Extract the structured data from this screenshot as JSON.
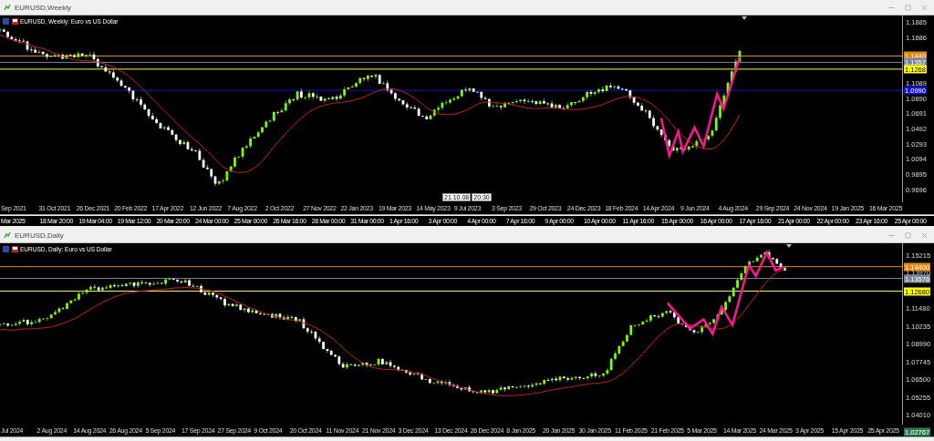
{
  "windows": [
    {
      "kind": "weekly",
      "title": "EURUSD,Weekly",
      "chart_header": "EURUSD, Weekly: Euro vs US Dollar",
      "price_ticks": [
        "1.1885",
        "1.1686",
        "1.1089",
        "1.0890",
        "1.0691",
        "1.0492",
        "1.0293",
        "1.0094",
        "0.9895",
        "0.9696"
      ],
      "price_tags": [
        {
          "label": "1.1440",
          "color": "#e8870e"
        },
        {
          "label": "1.1357",
          "color": "#7a8797"
        },
        {
          "label": "1.1268",
          "color": "#ffff00"
        },
        {
          "label": "1.0990",
          "color": "#1010d0"
        }
      ],
      "time_labels": [
        "Sep 2021",
        "31 Oct 2021",
        "26 Dec 2021",
        "20 Feb 2022",
        "17 Apr 2022",
        "12 Jun 2022",
        "7 Aug 2022",
        "2 Oct 2022",
        "27 Nov 2022",
        "22 Jan 2023",
        "19 Mar 2023",
        "14 May 2023",
        "9 Jul 2023",
        "3 Sep 2023",
        "29 Oct 2023",
        "24 Dec 2023",
        "18 Feb 2024",
        "14 Apr 2024",
        "9 Jun 2024",
        "4 Aug 2024",
        "29 Sep 2024",
        "24 Nov 2024",
        "19 Jan 2025",
        "16 Mar 2025"
      ],
      "crosshair_labels": [
        "21.10.08",
        "20:30"
      ]
    },
    {
      "kind": "daily",
      "title": "EURUSD,Daily",
      "chart_header": "EURUSD, Daily: Euro vs US Dollar",
      "price_ticks": [
        "1.15215",
        "1.13970",
        "1.11480",
        "1.10235",
        "1.08990",
        "1.07745",
        "1.06500",
        "1.05255",
        "1.04010"
      ],
      "price_tags": [
        {
          "label": "1.14400",
          "color": "#e8870e"
        },
        {
          "label": "1.13576",
          "color": "#7a8797"
        },
        {
          "label": "1.12680",
          "color": "#ffff00"
        },
        {
          "label": "1.02767",
          "color": "#2e7d4f"
        }
      ],
      "time_labels": [
        "Jul 2024",
        "2 Aug 2024",
        "14 Aug 2024",
        "26 Aug 2024",
        "5 Sep 2024",
        "17 Sep 2024",
        "27 Sep 2024",
        "9 Oct 2024",
        "20 Oct 2024",
        "11 Nov 2024",
        "21 Nov 2024",
        "3 Dec 2024",
        "13 Dec 2024",
        "26 Dec 2024",
        "8 Jan 2025",
        "20 Jan 2025",
        "30 Jan 2025",
        "11 Feb 2025",
        "21 Feb 2025",
        "5 Mar 2025",
        "14 Mar 2025",
        "24 Mar 2025",
        "3 Apr 2025",
        "15 Apr 2025",
        "25 Apr 2025"
      ]
    }
  ],
  "intraday_strip": {
    "time_labels": [
      "Mar 2025",
      "18 Mar 20:00",
      "19 Mar 04:00",
      "19 Mar 12:00",
      "20 Mar 20:00",
      "24 Mar 00:00",
      "25 Mar 00:00",
      "26 Mar 16:00",
      "28 Mar 00:00",
      "31 Mar 00:00",
      "1 Apr 16:00",
      "3 Apr 00:00",
      "4 Apr 00:00",
      "7 Apr 16:00",
      "9 Apr 00:00",
      "10 Apr 00:00",
      "11 Apr 16:00",
      "15 Apr 00:00",
      "16 Apr 00:00",
      "17 Apr 16:00",
      "21 Apr 00:00",
      "22 Apr 00:00",
      "23 Apr 16:00",
      "25 Apr 00:00"
    ]
  }
}
